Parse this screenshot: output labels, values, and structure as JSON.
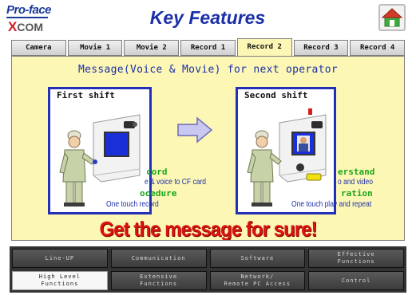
{
  "header": {
    "logo_brand": "Pro-face",
    "logo_sub_first": "X",
    "logo_sub_rest": "COM",
    "title": "Key Features"
  },
  "tabs": [
    {
      "label": "Camera",
      "active": false
    },
    {
      "label": "Movie 1",
      "active": false
    },
    {
      "label": "Movie 2",
      "active": false
    },
    {
      "label": "Record 1",
      "active": false
    },
    {
      "label": "Record 2",
      "active": true
    },
    {
      "label": "Record 3",
      "active": false
    },
    {
      "label": "Record 4",
      "active": false
    }
  ],
  "panel": {
    "heading": "Message(Voice & Movie) for next operator",
    "first_shift": {
      "title": "First shift",
      "green_1": "cord",
      "blue_1": "e & voice to CF card",
      "green_2": "ocedure",
      "blue_2": "One touch record"
    },
    "second_shift": {
      "title": "Second shift",
      "green_1": "erstand",
      "blue_1": "o and video",
      "green_2": "ration",
      "blue_2": "One touch play and repeat"
    },
    "slogan": "Get the message for sure!"
  },
  "nav": {
    "row1": [
      {
        "label": "Line-UP",
        "active": false
      },
      {
        "label": "Communication",
        "active": false
      },
      {
        "label": "Software",
        "active": false
      },
      {
        "label": "Effective\nFunctions",
        "active": false
      }
    ],
    "row2": [
      {
        "label": "High Level\nFunctions",
        "active": true
      },
      {
        "label": "Extensive\nFunctions",
        "active": false
      },
      {
        "label": "Network/\nRemote PC Access",
        "active": false
      },
      {
        "label": "Control",
        "active": false
      }
    ]
  },
  "colors": {
    "title_blue": "#1b2fa8",
    "panel_yellow": "#fdf7b5",
    "slogan_red": "#d9140f",
    "green_text": "#18a818",
    "frame_blue": "#2230b8"
  }
}
